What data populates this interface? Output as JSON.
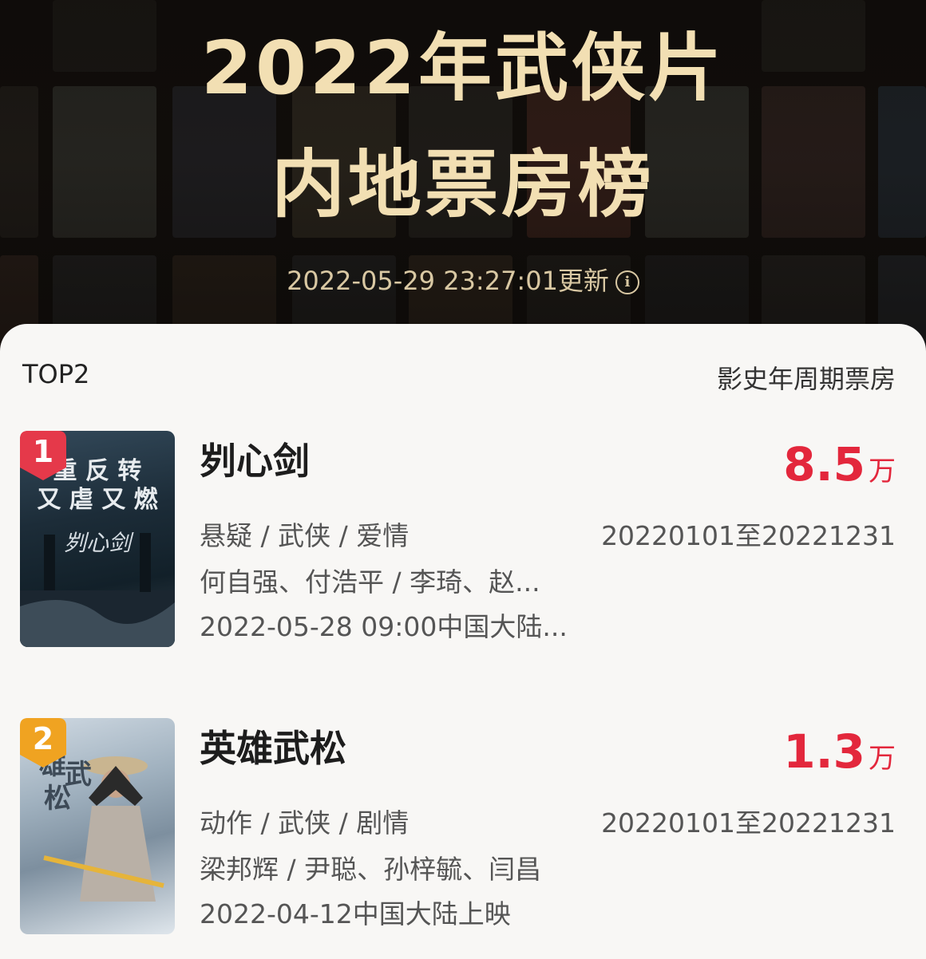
{
  "header": {
    "title_line1": "2022年武侠片",
    "title_line2": "内地票房榜",
    "update_text": "2022-05-29 23:27:01更新",
    "info_icon": "info-icon"
  },
  "list": {
    "count_label": "TOP2",
    "tab_label": "影史年周期票房"
  },
  "movies": [
    {
      "rank": "1",
      "rank_color": "#e5394a",
      "title": "刿心剑",
      "box_value": "8.5",
      "box_unit": "万",
      "genres": "悬疑 / 武侠 / 爱情",
      "cast": "何自强、付浩平 / 李琦、赵...",
      "release": "2022-05-28 09:00中国大陆...",
      "period": "20220101至20221231",
      "poster_text": [
        "重",
        "反",
        "转",
        "又",
        "虐",
        "又",
        "燃"
      ]
    },
    {
      "rank": "2",
      "rank_color": "#f0a321",
      "title": "英雄武松",
      "box_value": "1.3",
      "box_unit": "万",
      "genres": "动作 / 武侠 / 剧情",
      "cast": "梁邦辉 / 尹聪、孙梓毓、闫昌",
      "release": "2022-04-12中国大陆上映",
      "period": "20220101至20221231",
      "poster_text": [
        "雄",
        "武",
        "松"
      ]
    }
  ],
  "colors": {
    "accent": "#e3273c",
    "hero_title": "#f2dfb3",
    "rank1_badge": "#e5394a",
    "rank2_badge": "#f0a321"
  }
}
